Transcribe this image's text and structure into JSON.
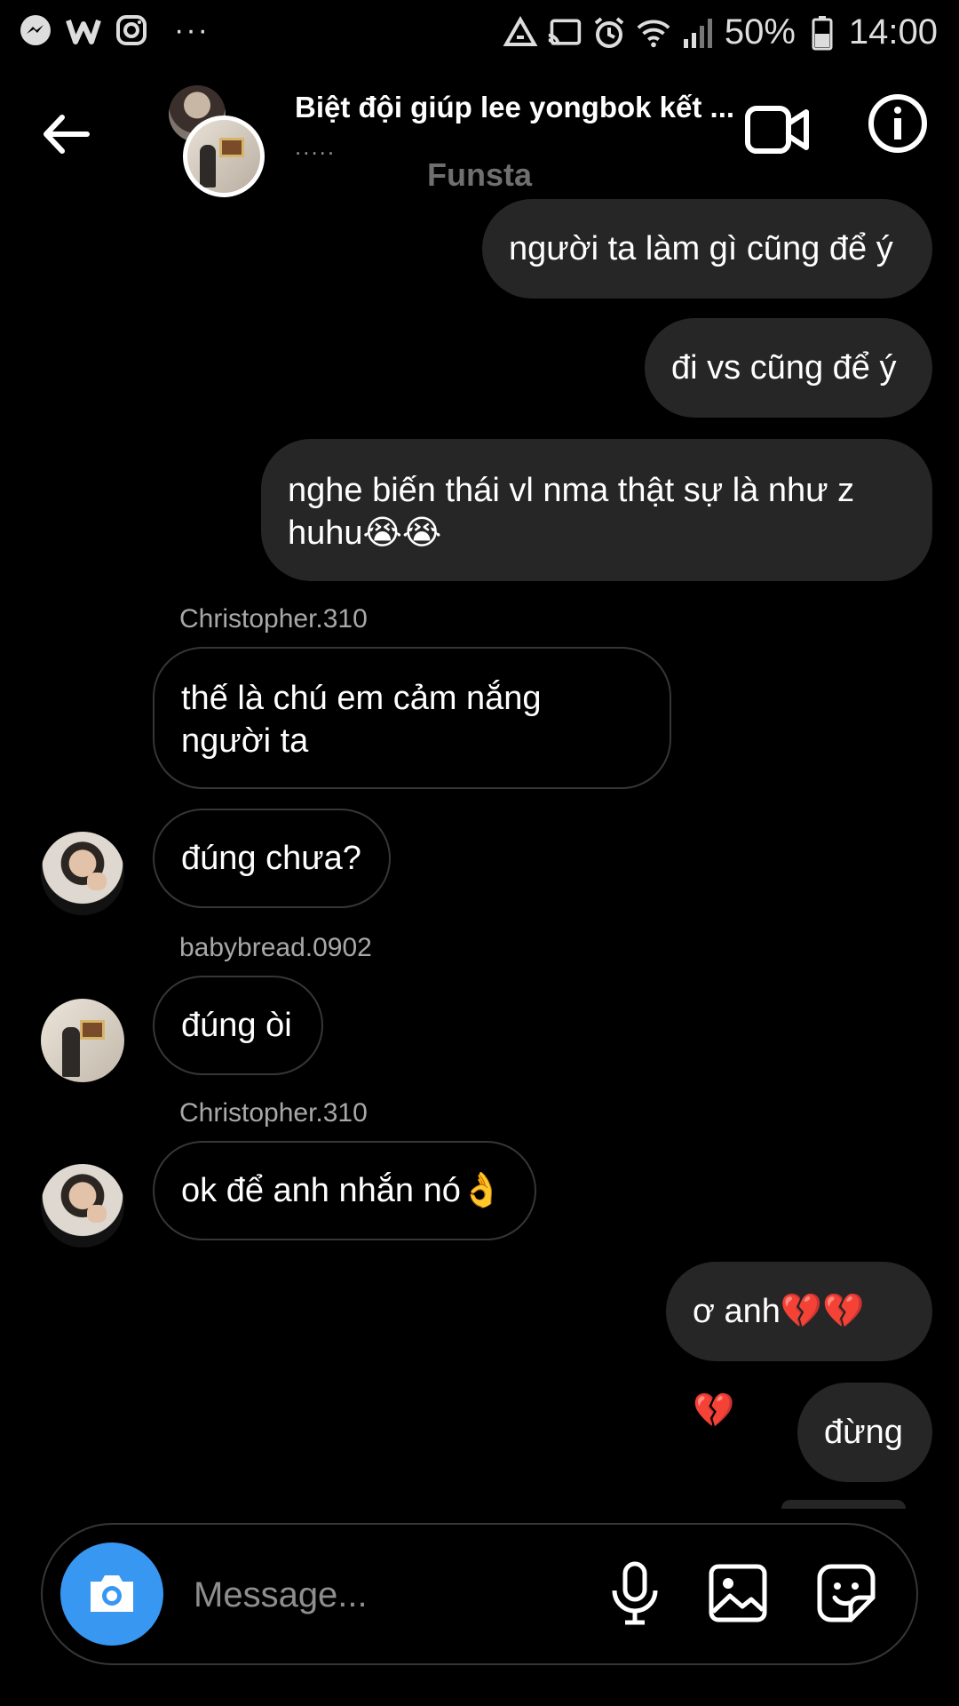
{
  "status_bar": {
    "battery": "50%",
    "time": "14:00",
    "dots": "···"
  },
  "header": {
    "title": "Biệt đội giúp lee yongbok kết ...",
    "subtitle": "....."
  },
  "banner": "Funsta",
  "messages": [
    {
      "direction": "out",
      "text": "người ta làm gì cũng để ý"
    },
    {
      "direction": "out",
      "text": "đi vs cũng để ý"
    },
    {
      "direction": "out",
      "text": "nghe biến thái vl nma thật sự là như z huhu😭😭"
    },
    {
      "direction": "in",
      "sender": "Christopher.310",
      "text": "thế là chú em cảm nắng người ta"
    },
    {
      "direction": "in",
      "text": "đúng chưa?"
    },
    {
      "direction": "in",
      "sender": "babybread.0902",
      "text": "đúng òi"
    },
    {
      "direction": "in",
      "sender": "Christopher.310",
      "text": "ok để anh nhắn nó👌"
    },
    {
      "direction": "out",
      "text": "ơ anh💔💔💔"
    },
    {
      "direction": "out",
      "text": "đừng"
    }
  ],
  "composer": {
    "placeholder": "Message..."
  },
  "icons": {
    "status_left": [
      "messenger-icon",
      "w-app-icon",
      "instagram-icon"
    ],
    "status_right": [
      "recycle-icon",
      "cast-icon",
      "alarm-icon",
      "wifi-icon",
      "signal-icon",
      "battery-icon"
    ],
    "header": [
      "back-arrow-icon",
      "video-call-icon",
      "info-icon"
    ],
    "composer": [
      "camera-icon",
      "microphone-icon",
      "gallery-icon",
      "sticker-icon"
    ]
  },
  "colors": {
    "background": "#000000",
    "outgoing_bubble": "#262626",
    "incoming_border": "#363636",
    "camera_button": "#3897f0",
    "muted_text": "#a8a8a8"
  }
}
